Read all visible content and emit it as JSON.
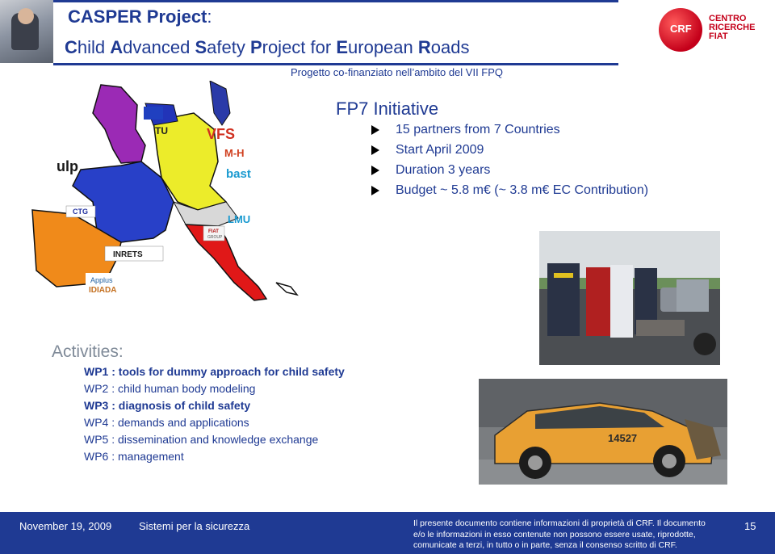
{
  "header": {
    "title_main": "CASPER Project",
    "title_colon": ":",
    "title_line2": [
      {
        "initial": "C",
        "rest": "hild "
      },
      {
        "initial": "A",
        "rest": "dvanced "
      },
      {
        "initial": "S",
        "rest": "afety "
      },
      {
        "initial": "P",
        "rest": "roject for "
      },
      {
        "initial": "E",
        "rest": "uropean "
      },
      {
        "initial": "R",
        "rest": "oads"
      }
    ],
    "subtitle": "Progetto co-finanziato nell’ambito del VII FPQ",
    "logo": {
      "circle_text": "CRF",
      "line1": "CENTRO",
      "line2": "RICERCHE",
      "line3": "FIAT"
    }
  },
  "map_logos": {
    "vfs": "VFS",
    "mh": "M-H",
    "bast": "bast",
    "lmu": "LMU",
    "ulp": "ulp",
    "fiat": "FIAT",
    "fiat_sub": "GROUP",
    "inrets": "INRETS",
    "applus": "Applus",
    "idiada": "IDIADA",
    "tu": "TU",
    "ctg": "CTG"
  },
  "fp7": {
    "title": "FP7 Initiative",
    "items": [
      "15 partners from 7 Countries",
      "Start  April 2009",
      "Duration  3 years",
      "Budget  ~ 5.8 m€ (~ 3.8 m€ EC Contribution)"
    ]
  },
  "activities": {
    "title": "Activities:",
    "items": [
      {
        "text": "WP1 : tools for dummy approach for child safety",
        "bold": true
      },
      {
        "text": "WP2 : child human body modeling",
        "bold": false
      },
      {
        "text": "WP3 : diagnosis of child safety",
        "bold": true
      },
      {
        "text": "WP4 : demands and applications",
        "bold": false
      },
      {
        "text": "WP5 : dissemination and knowledge exchange",
        "bold": false
      },
      {
        "text": "WP6 : management",
        "bold": false
      }
    ]
  },
  "photos": {
    "crash_car_label": "14527"
  },
  "footer": {
    "date": "November 19, 2009",
    "section": "Sistemi per la sicurezza",
    "note_lines": [
      "Il presente  documento contiene informazioni di proprietà di CRF. Il documento",
      "e/o le informazioni in esso contenute non possono essere usate, riprodotte,",
      "comunicate a terzi, in tutto o in parte, senza il consenso scritto di CRF."
    ],
    "page": "15"
  },
  "colors": {
    "accent": "#1f3a93",
    "brand_red": "#c4001a",
    "activities_title": "#7f8a98"
  }
}
